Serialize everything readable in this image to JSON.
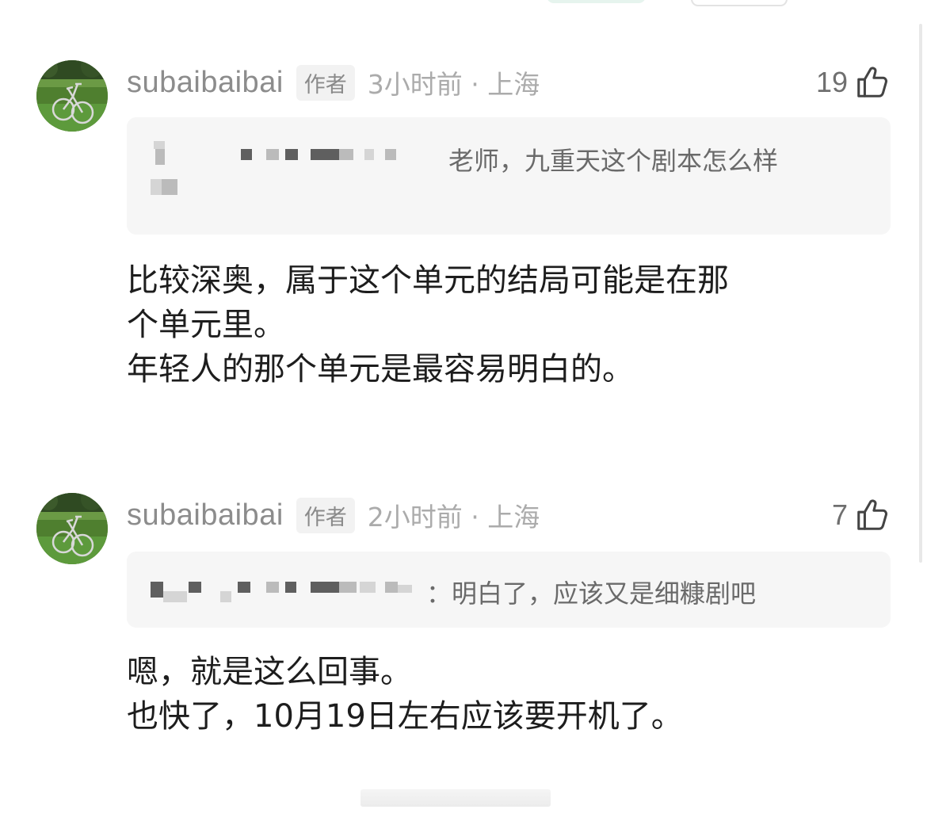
{
  "comments": [
    {
      "username": "subaibaibai",
      "badge": "作者",
      "time_location": "3小时前 · 上海",
      "likes": "19",
      "quote_text": "老师，九重天这个剧本怎么样",
      "reply_lines": [
        "比较深奥，属于这个单元的结局可能是在那",
        "个单元里。",
        "年轻人的那个单元是最容易明白的。"
      ]
    },
    {
      "username": "subaibaibai",
      "badge": "作者",
      "time_location": "2小时前 · 上海",
      "likes": "7",
      "quote_text": "：明白了，应该又是细糠剧吧",
      "reply_lines": [
        "嗯，就是这么回事。",
        "也快了，10月19日左右应该要开机了。"
      ]
    }
  ],
  "icons": {
    "like": "thumbs-up-icon",
    "avatar": "bicycle-photo"
  },
  "colors": {
    "username": "#8c8c8c",
    "meta": "#ababab",
    "quote_bg": "#f6f6f6"
  }
}
